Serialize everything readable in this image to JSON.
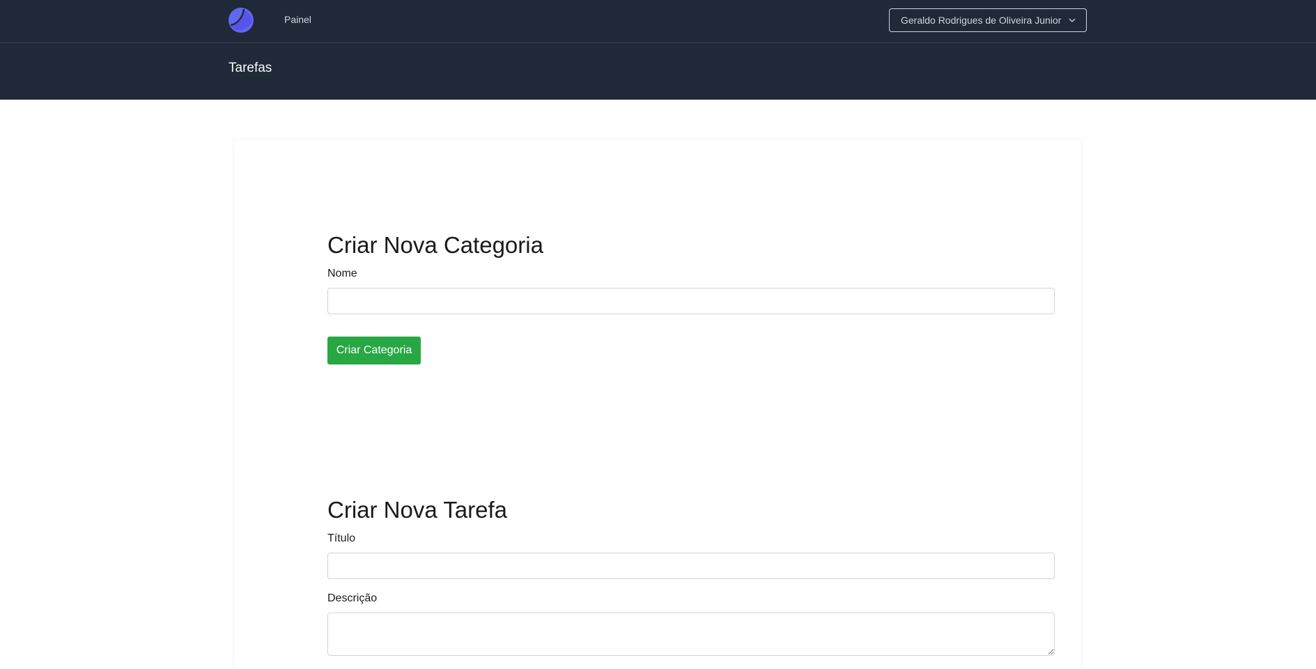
{
  "nav": {
    "logo_icon": "crescent-logo-icon",
    "painel_label": "Painel",
    "user_name": "Geraldo Rodrigues de Oliveira Junior",
    "dropdown_icon": "chevron-down-icon"
  },
  "header": {
    "title": "Tarefas"
  },
  "category_form": {
    "title": "Criar Nova Categoria",
    "name_label": "Nome",
    "name_value": "",
    "submit_label": "Criar Categoria"
  },
  "task_form": {
    "title": "Criar Nova Tarefa",
    "title_label": "Título",
    "title_value": "",
    "description_label": "Descrição",
    "description_value": ""
  },
  "colors": {
    "nav_bg": "#1f2937",
    "logo": "#6366f1",
    "primary_button": "#28a745"
  }
}
